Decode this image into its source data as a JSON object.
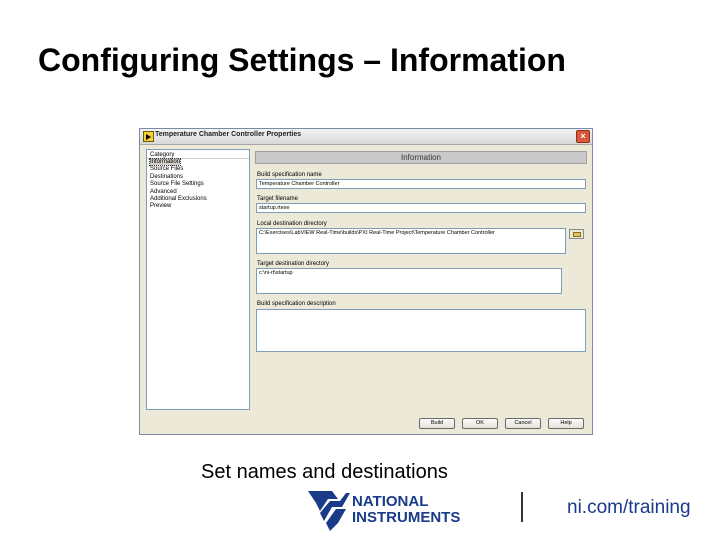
{
  "slide": {
    "title": "Configuring Settings – Information",
    "subtitle": "Set names and destinations",
    "footer_link": "ni.com/training",
    "logo_text_1": "NATIONAL",
    "logo_text_2": "INSTRUMENTS"
  },
  "dialog": {
    "title": "Temperature Chamber Controller Properties",
    "close_glyph": "×",
    "category_header": "Category",
    "categories": [
      {
        "label": "Information",
        "selected": true
      },
      {
        "label": "Source Files",
        "selected": false
      },
      {
        "label": "Destinations",
        "selected": false
      },
      {
        "label": "Source File Settings",
        "selected": false
      },
      {
        "label": "Advanced",
        "selected": false
      },
      {
        "label": "Additional Exclusions",
        "selected": false
      },
      {
        "label": "Preview",
        "selected": false
      }
    ],
    "panel_header": "Information",
    "fields": {
      "build_spec_name_label": "Build specification name",
      "build_spec_name_value": "Temperature Chamber Controller",
      "target_filename_label": "Target filename",
      "target_filename_value": "startup.rtexe",
      "local_dest_dir_label": "Local destination directory",
      "local_dest_dir_value": "C:\\Exercises\\LabVIEW Real-Time\\builds\\PXI Real-Time Project\\Temperature Chamber Controller",
      "target_dest_dir_label": "Target destination directory",
      "target_dest_dir_value": "c:\\ni-rt\\startup",
      "description_label": "Build specification description",
      "description_value": ""
    },
    "buttons": {
      "build": "Build",
      "ok": "OK",
      "cancel": "Cancel",
      "help": "Help"
    }
  },
  "icons": {
    "app": "labview-vi-icon",
    "close": "close-icon",
    "browse": "folder-icon",
    "logo": "ni-eagle-logo"
  },
  "colors": {
    "dialog_bg": "#ece9d8",
    "footer_link": "#1a3a8a",
    "logo_blue": "#1a3a8a"
  }
}
